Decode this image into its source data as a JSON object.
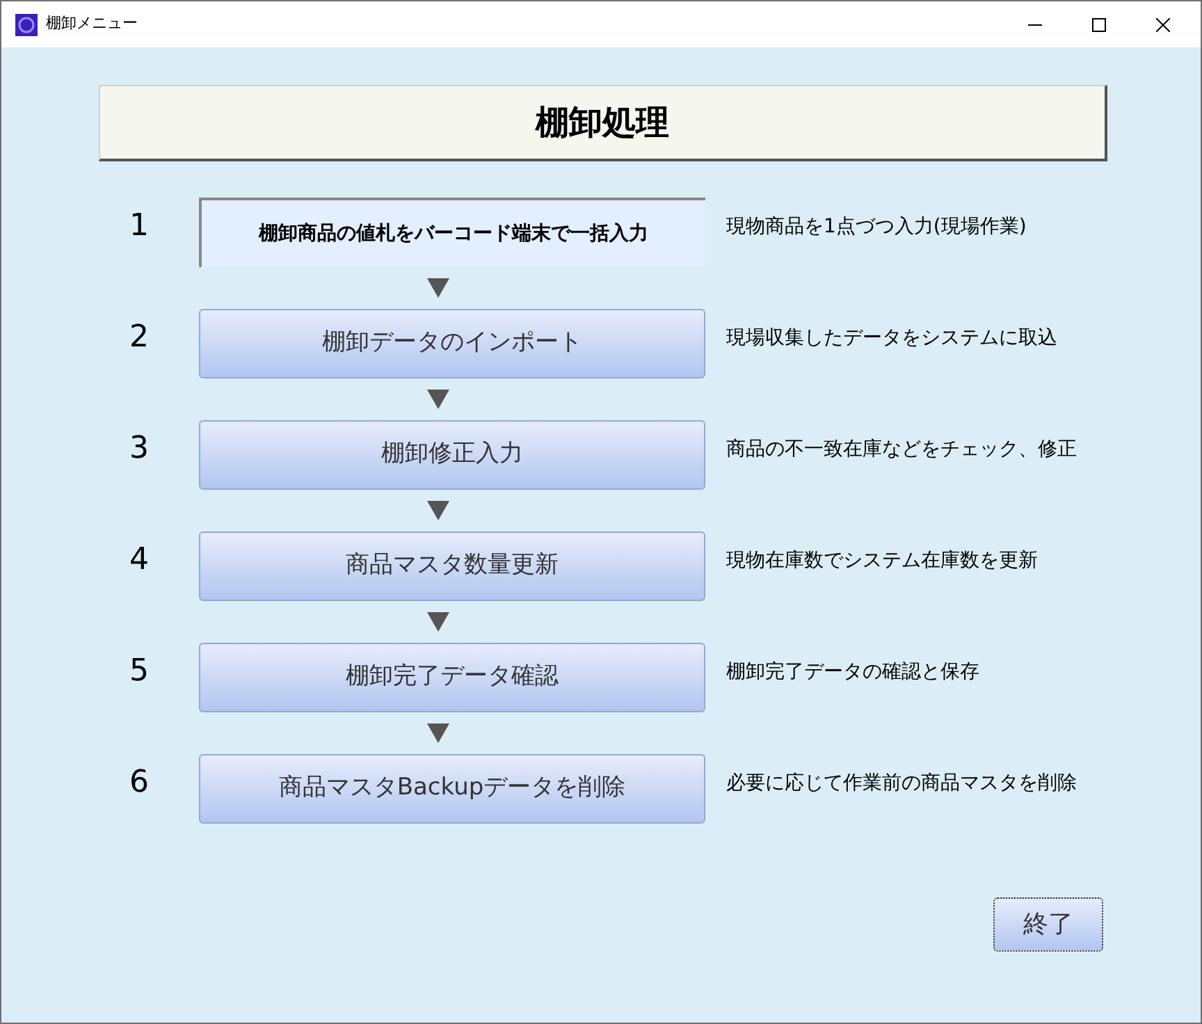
{
  "window": {
    "title": "棚卸メニュー"
  },
  "header": "棚卸処理",
  "steps": [
    {
      "number": "1",
      "label": "棚卸商品の値札をバーコード端末で一括入力",
      "kind": "label",
      "description": "現物商品を1点づつ入力(現場作業)"
    },
    {
      "number": "2",
      "label": "棚卸データのインポート",
      "kind": "button",
      "description": "現場収集したデータをシステムに取込"
    },
    {
      "number": "3",
      "label": "棚卸修正入力",
      "kind": "button",
      "description": "商品の不一致在庫などをチェック、修正"
    },
    {
      "number": "4",
      "label": "商品マスタ数量更新",
      "kind": "button",
      "description": "現物在庫数でシステム在庫数を更新"
    },
    {
      "number": "5",
      "label": "棚卸完了データ確認",
      "kind": "button",
      "description": "棚卸完了データの確認と保存"
    },
    {
      "number": "6",
      "label": "商品マスタBackupデータを削除",
      "kind": "button",
      "description": "必要に応じて作業前の商品マスタを削除"
    }
  ],
  "exit_button": {
    "label": "終了",
    "focused": true
  }
}
